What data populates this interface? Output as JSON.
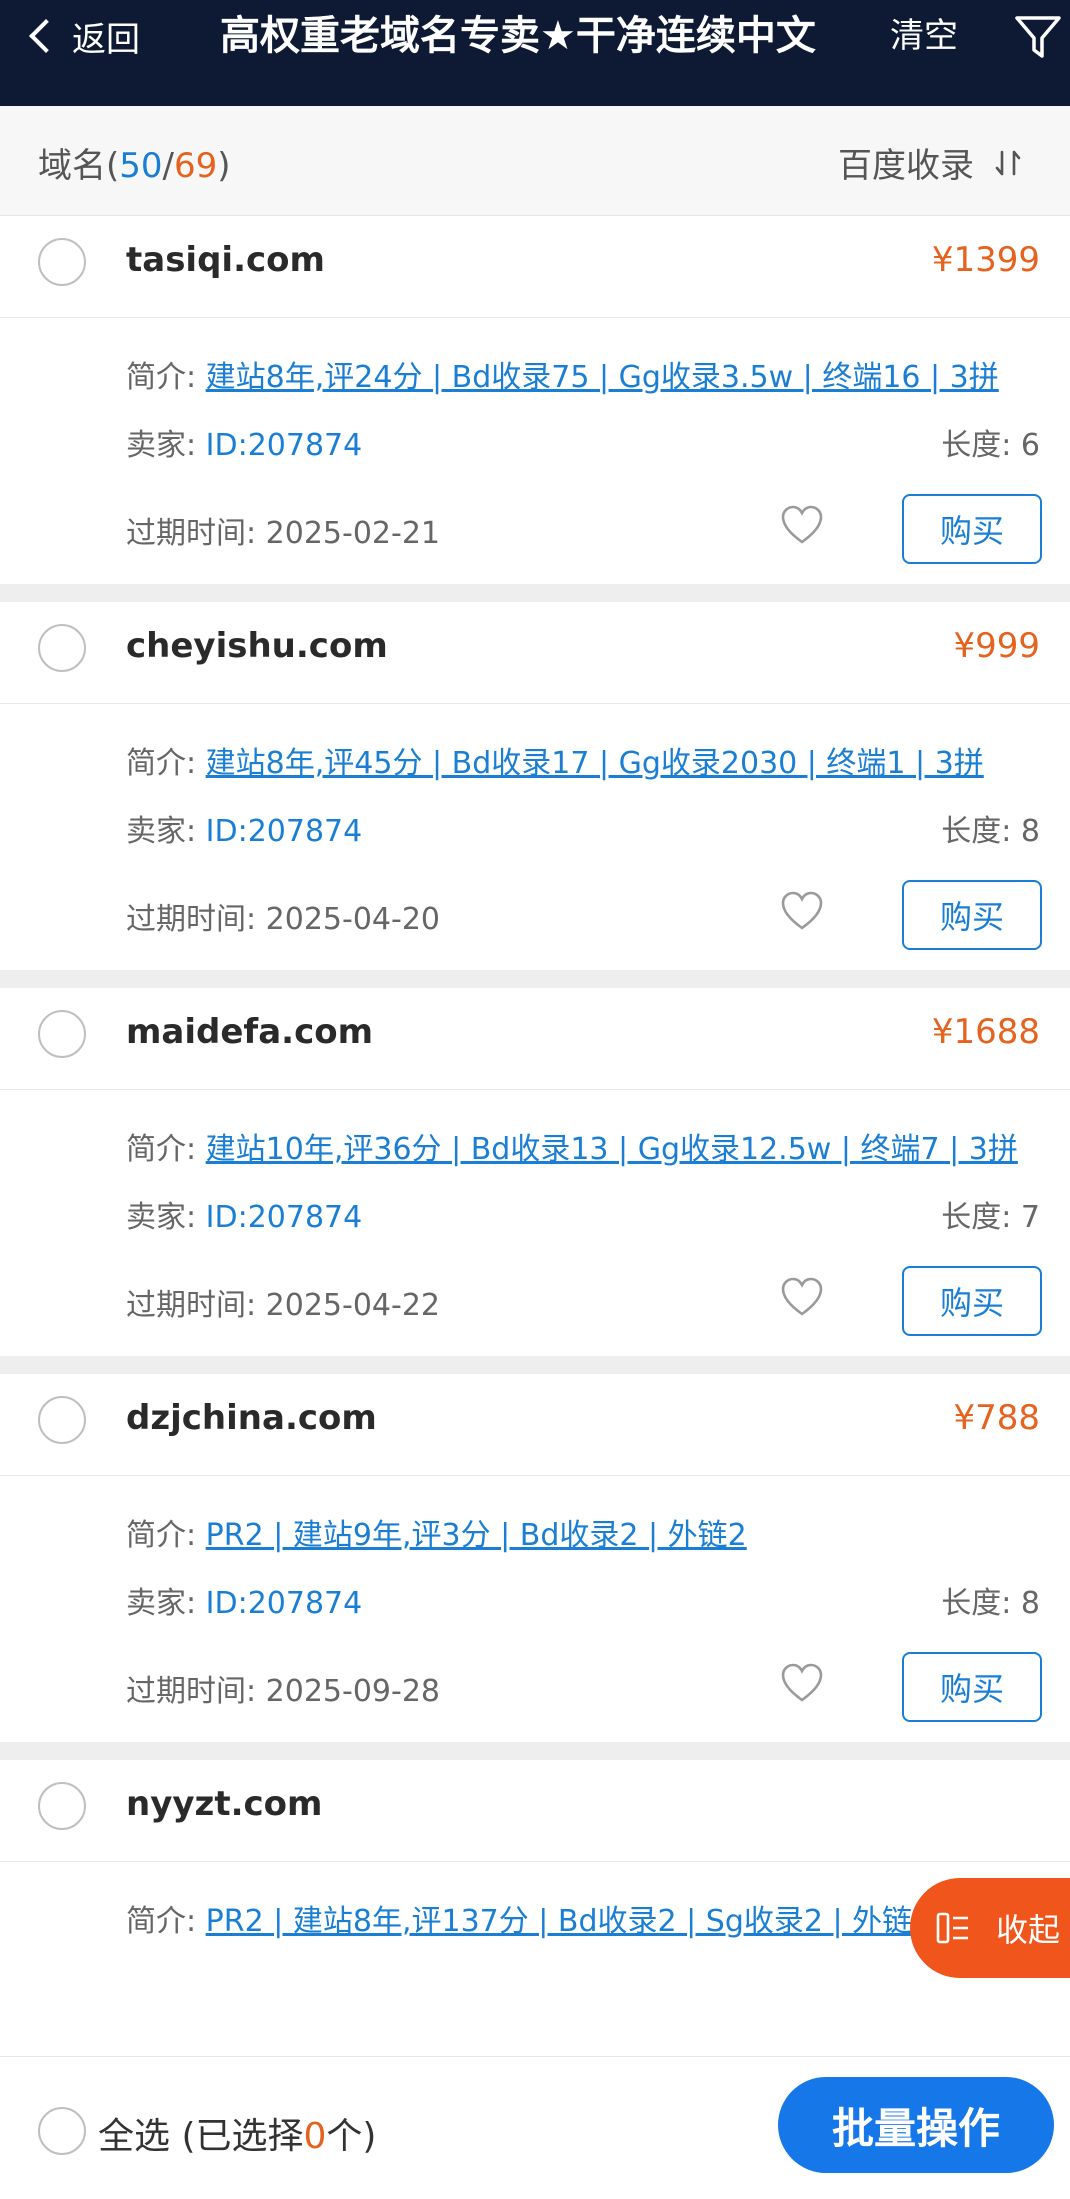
{
  "header": {
    "back_label": "返回",
    "title": "高权重老域名专卖★干净连续中文",
    "clear_label": "清空",
    "bg_color": "#0e1a33"
  },
  "sortbar": {
    "label_prefix": "域名(",
    "selected_count": "50",
    "separator": "/",
    "total_count": "69",
    "label_suffix": ")",
    "sort_label": "百度收录"
  },
  "labels": {
    "intro": "简介:",
    "seller": "卖家:",
    "length": "长度:",
    "expire": "过期时间:",
    "buy": "购买"
  },
  "items": [
    {
      "domain": "tasiqi.com",
      "price": "¥1399",
      "intro": "建站8年,评24分 | Bd收录75 | Gg收录3.5w | 终端16 | 3拼",
      "seller": "ID:207874",
      "length": "6",
      "expire": "2025-02-21"
    },
    {
      "domain": "cheyishu.com",
      "price": "¥999",
      "intro": "建站8年,评45分 | Bd收录17 | Gg收录2030 | 终端1 | 3拼",
      "seller": "ID:207874",
      "length": "8",
      "expire": "2025-04-20"
    },
    {
      "domain": "maidefa.com",
      "price": "¥1688",
      "intro": "建站10年,评36分 | Bd收录13 | Gg收录12.5w | 终端7 | 3拼",
      "seller": "ID:207874",
      "length": "7",
      "expire": "2025-04-22"
    },
    {
      "domain": "dzjchina.com",
      "price": "¥788",
      "intro": "PR2 | 建站9年,评3分 | Bd收录2 | 外链2",
      "seller": "ID:207874",
      "length": "8",
      "expire": "2025-09-28"
    },
    {
      "domain": "nyyzt.com",
      "intro": "PR2 | 建站8年,评137分 | Bd收录2 | Sg收录2 | 外链2 | 终端2"
    }
  ],
  "floating": {
    "collapse_label": "收起",
    "color": "#f0561c"
  },
  "footer": {
    "select_all_prefix": "全选 (已选择",
    "selected_num": "0",
    "select_all_suffix": "个)",
    "batch_label": "批量操作",
    "batch_color": "#1677e8"
  },
  "colors": {
    "accent_blue": "#1a7fd4",
    "price_orange": "#e5621f"
  }
}
